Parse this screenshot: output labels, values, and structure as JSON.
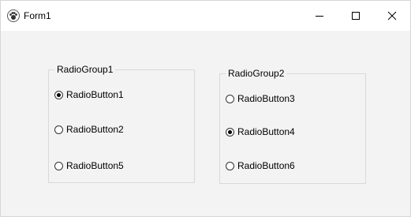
{
  "window": {
    "title": "Form1",
    "app_icon": "paw-icon",
    "controls": [
      "minimize-icon",
      "maximize-icon",
      "close-icon"
    ]
  },
  "groups": [
    {
      "caption": "RadioGroup1",
      "buttons": [
        {
          "label": "RadioButton1",
          "checked": true
        },
        {
          "label": "RadioButton2",
          "checked": false
        },
        {
          "label": "RadioButton5",
          "checked": false
        }
      ]
    },
    {
      "caption": "RadioGroup2",
      "buttons": [
        {
          "label": "RadioButton3",
          "checked": false
        },
        {
          "label": "RadioButton4",
          "checked": true
        },
        {
          "label": "RadioButton6",
          "checked": false
        }
      ]
    }
  ]
}
